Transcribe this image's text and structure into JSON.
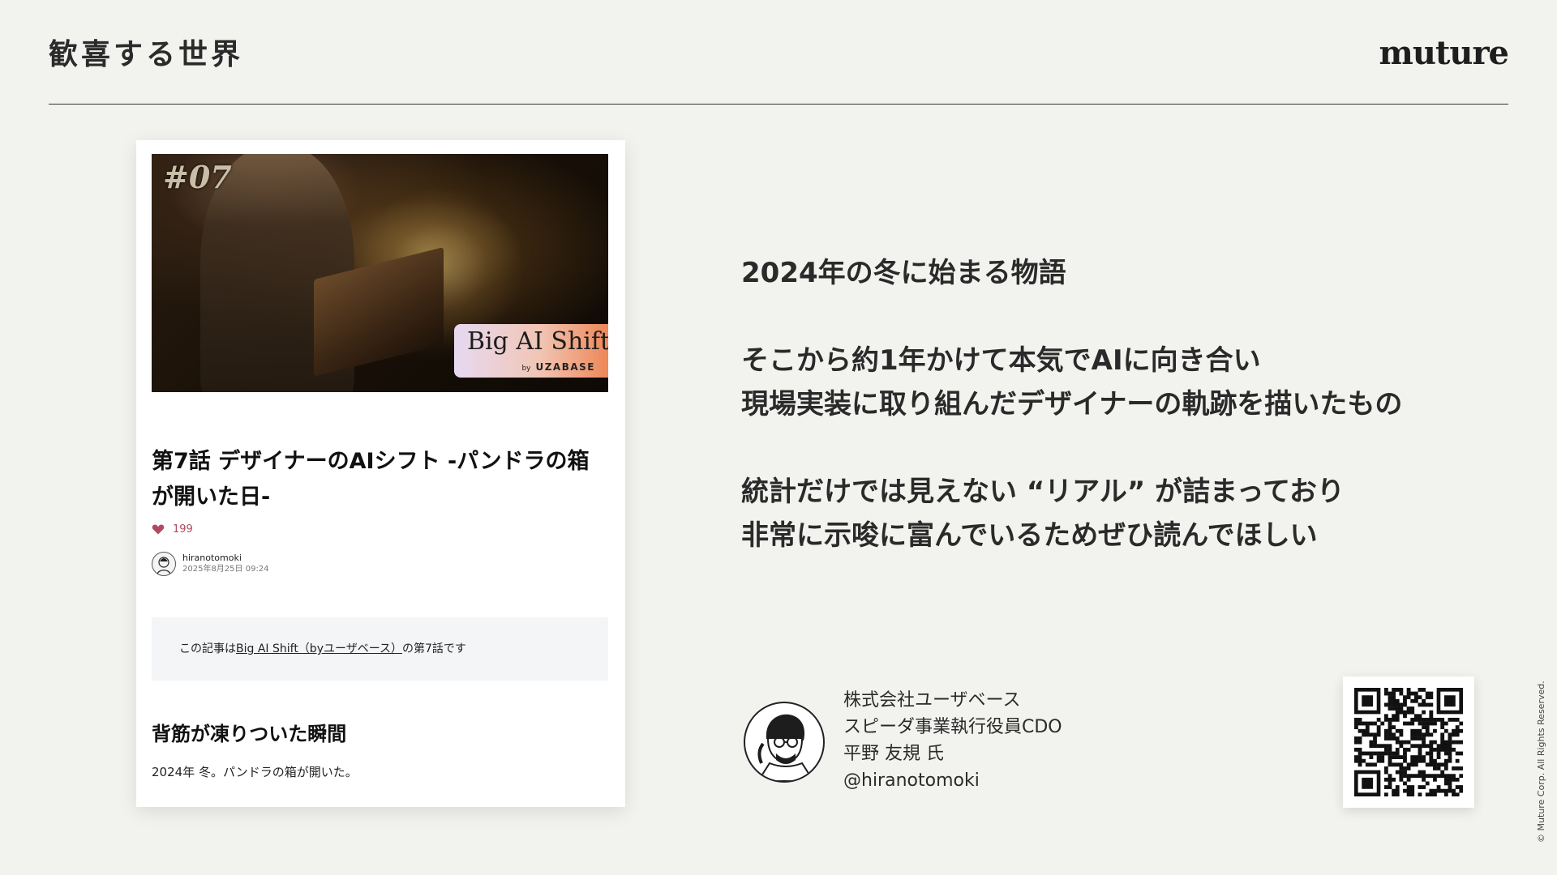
{
  "header": {
    "title": "歓喜する世界",
    "logo_text": "muture"
  },
  "article_card": {
    "hero": {
      "episode_label": "#07",
      "badge_title": "Big AI Shift",
      "badge_by": "by",
      "badge_sub": "UZABASE"
    },
    "title": "第7話 デザイナーのAIシフト -パンドラの箱が開いた日-",
    "likes": "199",
    "author_name": "hiranotomoki",
    "author_date": "2025年8月25日 09:24",
    "note_prefix": "この記事は",
    "note_link": "Big AI Shift（byユーザベース）",
    "note_suffix": "の第7話です",
    "section_heading": "背筋が凍りついた瞬間",
    "section_body": "2024年 冬。パンドラの箱が開いた。"
  },
  "story": {
    "line1": "2024年の冬に始まる物語",
    "line2": "そこから約1年かけて本気でAIに向き合い",
    "line3": "現場実装に取り組んだデザイナーの軌跡を描いたもの",
    "line4": "統計だけでは見えない “リアル” が詰まっており",
    "line5": "非常に示唆に富んでいるためぜひ読んでほしい"
  },
  "profile": {
    "company": "株式会社ユーザベース",
    "role": "スピーダ事業執行役員CDO",
    "name": "平野 友規 氏",
    "handle": "@hiranotomoki"
  },
  "footer": {
    "copyright": "© Muture Corp. All Rights Reserved."
  },
  "colors": {
    "background": "#f2f2ef",
    "like_heart": "#b14a5e",
    "badge_gradient_end": "#ee8757"
  }
}
